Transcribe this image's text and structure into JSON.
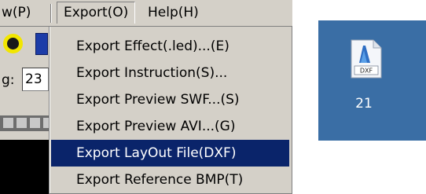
{
  "menubar": {
    "view_label": "w(P)",
    "export_label": "Export(O)",
    "help_label": "Help(H)"
  },
  "toolbar": {
    "field_label": "g:",
    "field_value": "23"
  },
  "export_menu": {
    "items": [
      {
        "label": "Export Effect(.led)...(E)"
      },
      {
        "label": "Export Instruction(S)..."
      },
      {
        "label": "Export Preview SWF...(S)"
      },
      {
        "label": "Export Preview AVI...(G)"
      },
      {
        "label": "Export LayOut File(DXF)",
        "selected": true
      },
      {
        "label": "Export Reference BMP(T)"
      }
    ]
  },
  "desktop_file": {
    "icon": "dxf-file-icon",
    "badge": "DXF",
    "label": "21"
  },
  "colors": {
    "menu_bg": "#d4d0c8",
    "selection": "#0a246a",
    "desktop_bg": "#3a6ea5"
  }
}
